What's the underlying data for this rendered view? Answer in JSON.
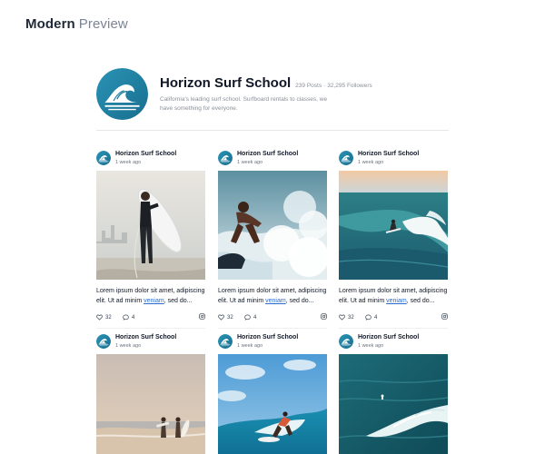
{
  "header": {
    "title_bold": "Modern",
    "title_light": "Preview"
  },
  "profile": {
    "name": "Horizon Surf School",
    "posts": "239 Posts",
    "followers": "32,295 Followers",
    "bio": "California's leading surf school. Surfboard rentals to classes, we have something for everyone."
  },
  "colors": {
    "brand": "#1f7fa0",
    "link": "#2a6bd1"
  },
  "posts": [
    {
      "author": "Horizon Surf School",
      "time": "1 week ago",
      "image": "surfer-holding-board-beach",
      "caption_start": "Lorem ipsum dolor sit amet, adipiscing elit. Ut ad minim ",
      "caption_link": "veniam",
      "caption_end": ", sed do...",
      "likes": "32",
      "comments": "4"
    },
    {
      "author": "Horizon Surf School",
      "time": "1 week ago",
      "image": "surfer-riding-wave-spray",
      "caption_start": "Lorem ipsum dolor sit amet, adipiscing elit. Ut ad minim ",
      "caption_link": "veniam",
      "caption_end": ", sed do...",
      "likes": "32",
      "comments": "4"
    },
    {
      "author": "Horizon Surf School",
      "time": "1 week ago",
      "image": "surfer-on-wave-sunset",
      "caption_start": "Lorem ipsum dolor sit amet, adipiscing elit. Ut ad minim ",
      "caption_link": "veniam",
      "caption_end": ", sed do...",
      "likes": "32",
      "comments": "4"
    },
    {
      "author": "Horizon Surf School",
      "time": "1 week ago",
      "image": "surfers-walking-shore",
      "caption_start": "",
      "caption_link": "",
      "caption_end": "",
      "likes": "",
      "comments": ""
    },
    {
      "author": "Horizon Surf School",
      "time": "1 week ago",
      "image": "surfer-blue-sky-wave",
      "caption_start": "",
      "caption_link": "",
      "caption_end": "",
      "likes": "",
      "comments": ""
    },
    {
      "author": "Horizon Surf School",
      "time": "1 week ago",
      "image": "aerial-wave-surfer",
      "caption_start": "",
      "caption_link": "",
      "caption_end": "",
      "likes": "",
      "comments": ""
    }
  ]
}
